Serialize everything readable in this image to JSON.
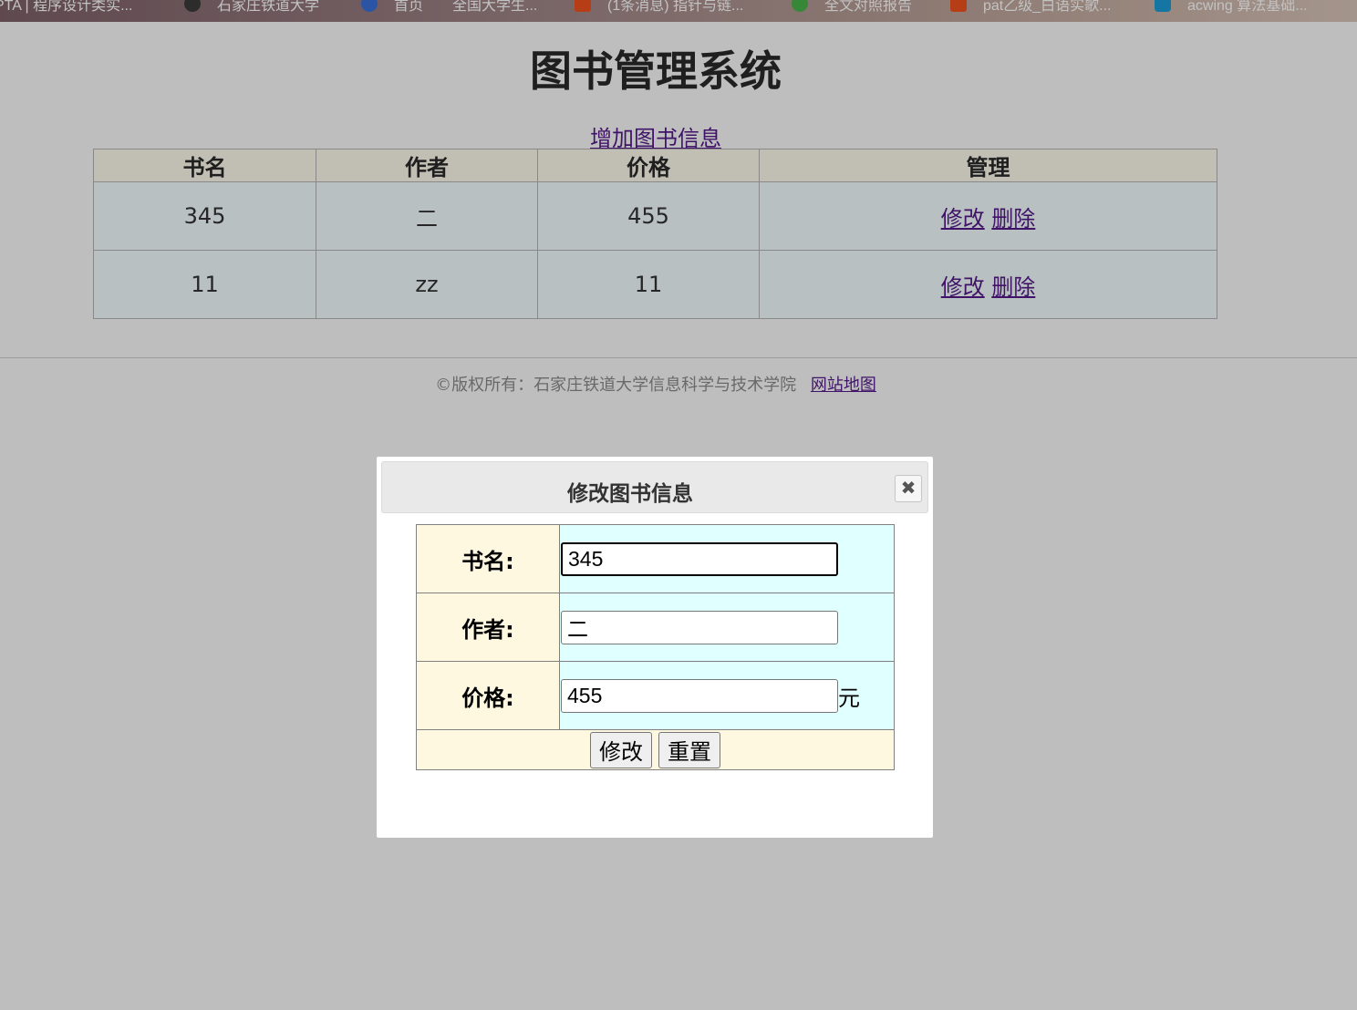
{
  "bookmarks": [
    {
      "label": "PTA | 程序设计类实...",
      "color": "#ffffff"
    },
    {
      "label": "石家庄铁道大学",
      "color": "#3a3a3a"
    },
    {
      "label": "首页",
      "color": "#3b6fd8"
    },
    {
      "label": "全国大学生...",
      "color": "#a0a0a0"
    },
    {
      "label": "(1条消息) 指针与链...",
      "color": "#f0521d"
    },
    {
      "label": "全文对照报告",
      "color": "#49b24b"
    },
    {
      "label": "pat乙级_白语实歌...",
      "color": "#f0521d"
    },
    {
      "label": "acwing 算法基础...",
      "color": "#1e9bd7"
    }
  ],
  "page": {
    "title": "图书管理系统",
    "add_link": "增加图书信息"
  },
  "table": {
    "headers": [
      "书名",
      "作者",
      "价格",
      "管理"
    ],
    "rows": [
      {
        "name": "345",
        "author": "二",
        "price": "455",
        "edit": "修改",
        "delete": "删除"
      },
      {
        "name": "11",
        "author": "zz",
        "price": "11",
        "edit": "修改",
        "delete": "删除"
      }
    ]
  },
  "footer": {
    "copyright": "©版权所有：石家庄铁道大学信息科学与技术学院",
    "sitemap": "网站地图"
  },
  "dialog": {
    "title": "修改图书信息",
    "close_icon": "close-icon",
    "fields": {
      "name_label": "书名:",
      "name_value": "345",
      "author_label": "作者:",
      "author_value": "二",
      "price_label": "价格:",
      "price_value": "455",
      "price_unit": "元"
    },
    "submit_label": "修改",
    "reset_label": "重置"
  }
}
